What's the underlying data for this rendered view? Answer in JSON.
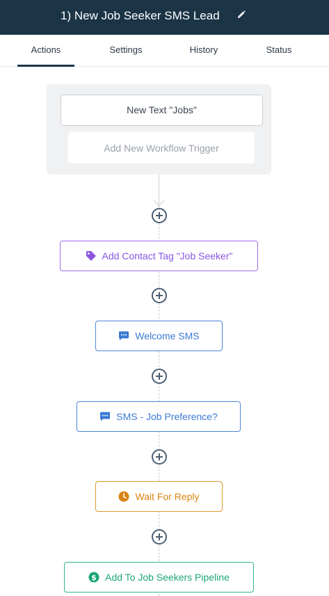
{
  "header": {
    "title": "1) New Job Seeker SMS Lead",
    "edit_icon": "pencil-icon"
  },
  "tabs": [
    {
      "label": "Actions",
      "active": true
    },
    {
      "label": "Settings",
      "active": false
    },
    {
      "label": "History",
      "active": false
    },
    {
      "label": "Status",
      "active": false
    }
  ],
  "triggers": {
    "items": [
      {
        "label": "New Text \"Jobs\""
      }
    ],
    "add_label": "Add New Workflow Trigger"
  },
  "actions": [
    {
      "label": "Add Contact Tag \"Job Seeker\"",
      "icon": "tag-icon",
      "color": "#8a56e0"
    },
    {
      "label": "Welcome SMS",
      "icon": "chat-bubble-icon",
      "color": "#3b7ad4"
    },
    {
      "label": "SMS - Job Preference?",
      "icon": "chat-bubble-icon",
      "color": "#3b7ad4"
    },
    {
      "label": "Wait For Reply",
      "icon": "clock-icon",
      "color": "#d98412"
    },
    {
      "label": "Add To Job Seekers Pipeline",
      "icon": "dollar-icon",
      "color": "#1ca577"
    }
  ],
  "colors": {
    "header_bg": "#1b3446",
    "connector": "#c2c7cd",
    "add_step": "#4a5d70"
  }
}
